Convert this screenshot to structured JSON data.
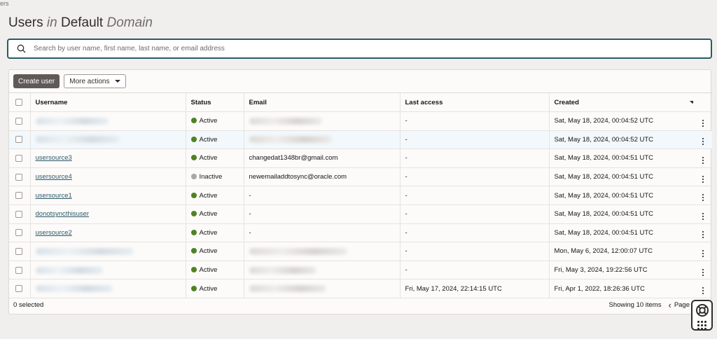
{
  "breadcrumb": "ers",
  "title": {
    "prefix": "Users",
    "in": "in",
    "domain_word": "Default",
    "domain_suffix": "Domain"
  },
  "search": {
    "placeholder": "Search by user name, first name, last name, or email address"
  },
  "toolbar": {
    "create_label": "Create user",
    "more_label": "More actions"
  },
  "table": {
    "headers": {
      "username": "Username",
      "status": "Status",
      "email": "Email",
      "last_access": "Last access",
      "created": "Created"
    },
    "rows": [
      {
        "username": "",
        "status": "Active",
        "email": "",
        "last_access": "-",
        "created": "Sat, May 18, 2024, 00:04:52 UTC"
      },
      {
        "username": "",
        "status": "Active",
        "email": "",
        "last_access": "-",
        "created": "Sat, May 18, 2024, 00:04:52 UTC"
      },
      {
        "username": "usersource3",
        "status": "Active",
        "email": "changedat1348br@gmail.com",
        "last_access": "-",
        "created": "Sat, May 18, 2024, 00:04:51 UTC"
      },
      {
        "username": "usersource4",
        "status": "Inactive",
        "email": "newemailaddtosync@oracle.com",
        "last_access": "-",
        "created": "Sat, May 18, 2024, 00:04:51 UTC"
      },
      {
        "username": "usersource1",
        "status": "Active",
        "email": "-",
        "last_access": "-",
        "created": "Sat, May 18, 2024, 00:04:51 UTC"
      },
      {
        "username": "donotsyncthisuser",
        "status": "Active",
        "email": "-",
        "last_access": "-",
        "created": "Sat, May 18, 2024, 00:04:51 UTC"
      },
      {
        "username": "usersource2",
        "status": "Active",
        "email": "-",
        "last_access": "-",
        "created": "Sat, May 18, 2024, 00:04:51 UTC"
      },
      {
        "username": "",
        "status": "Active",
        "email": "",
        "last_access": "-",
        "created": "Mon, May 6, 2024, 12:00:07 UTC"
      },
      {
        "username": "",
        "status": "Active",
        "email": "",
        "last_access": "-",
        "created": "Fri, May 3, 2024, 19:22:56 UTC"
      },
      {
        "username": "",
        "status": "Active",
        "email": "",
        "last_access": "Fri, May 17, 2024, 22:14:15 UTC",
        "created": "Fri, Apr 1, 2022, 18:26:36 UTC"
      }
    ]
  },
  "footer": {
    "selected": "0 selected",
    "showing": "Showing 10 items",
    "page_label": "Page"
  },
  "colors": {
    "active": "#508223",
    "inactive": "#a9a6a3",
    "link": "#2c5967",
    "primary_button": "#5f5a56"
  },
  "icons": [
    "search-icon",
    "caret-down-icon",
    "sort-caret-icon",
    "kebab-icon",
    "chevron-left-icon",
    "help-lifebuoy-icon",
    "apps-grid-icon"
  ]
}
